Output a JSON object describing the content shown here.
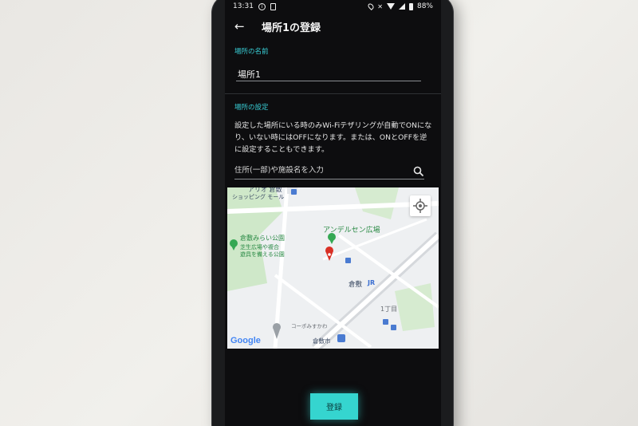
{
  "status_bar": {
    "time": "13:31",
    "battery": "88%",
    "left_icons": [
      "info-icon",
      "save-icon"
    ],
    "right_icons": [
      "location-icon",
      "mute-icon",
      "wifi-icon",
      "signal-icon",
      "battery-icon"
    ]
  },
  "app_bar": {
    "title": "場所1の登録",
    "back_icon": "back-arrow-icon"
  },
  "place_name": {
    "label": "場所の名前",
    "value": "場所1"
  },
  "place_settings": {
    "label": "場所の設定",
    "description": "設定した場所にいる時のみWi-Fiテザリングが自動でONになり、いない時にはOFFになります。または、ONとOFFを逆に設定することもできます。"
  },
  "search": {
    "placeholder": "住所(一部)や施設名を入力",
    "icon": "search-icon"
  },
  "map": {
    "labels": {
      "top_poi": "アリオ 倉敷",
      "top_poi_sub": "ショッピング モール",
      "park": "倉敷みらい公園",
      "park_desc_1": "芝生広場や複合",
      "park_desc_2": "遊具を備える公園",
      "square": "アンデルセン広場",
      "station": "倉敷",
      "station_jr": "JR",
      "chome": "1丁目",
      "store": "コーポみすかわ",
      "city": "倉敷市"
    },
    "logo": "Google",
    "locate_icon": "my-location-icon",
    "colors": {
      "park_green": "#cfe8c9",
      "label_green": "#2a8a45",
      "road": "#ffffff",
      "pin_red": "#d93025"
    }
  },
  "register_button": {
    "label": "登録"
  },
  "colors": {
    "accent": "#39d0d8",
    "button": "#35d5cf",
    "screen_bg": "#0d0d0f"
  }
}
